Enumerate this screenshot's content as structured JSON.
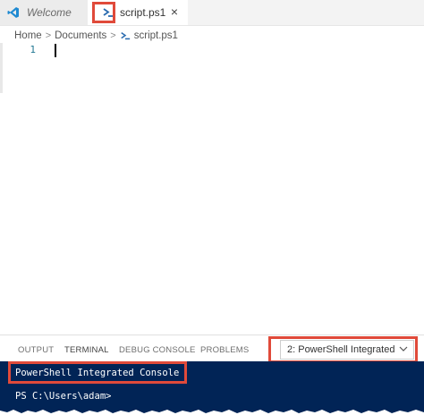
{
  "tabs": {
    "welcome_label": "Welcome",
    "script_label": "script.ps1",
    "close_glyph": "×"
  },
  "breadcrumb": {
    "home": "Home",
    "documents": "Documents",
    "file": "script.ps1",
    "separator": ">"
  },
  "editor": {
    "line_number": "1"
  },
  "panel": {
    "tabs": [
      "OUTPUT",
      "TERMINAL",
      "DEBUG CONSOLE",
      "PROBLEMS"
    ],
    "active_tab": "TERMINAL",
    "terminal_select_value": "2: PowerShell Integrated"
  },
  "terminal": {
    "console_title": "PowerShell Integrated Console",
    "prompt": "PS C:\\Users\\adam>"
  },
  "colors": {
    "highlight": "#e04a3a",
    "terminal_bg": "#012456",
    "powershell_icon": "#2b6cb0",
    "vscode_icon": "#1f8ad2"
  },
  "icons": {
    "welcome_tab": "vscode-logo-icon",
    "script_tab": "powershell-icon",
    "select": "chevron-down-icon"
  }
}
